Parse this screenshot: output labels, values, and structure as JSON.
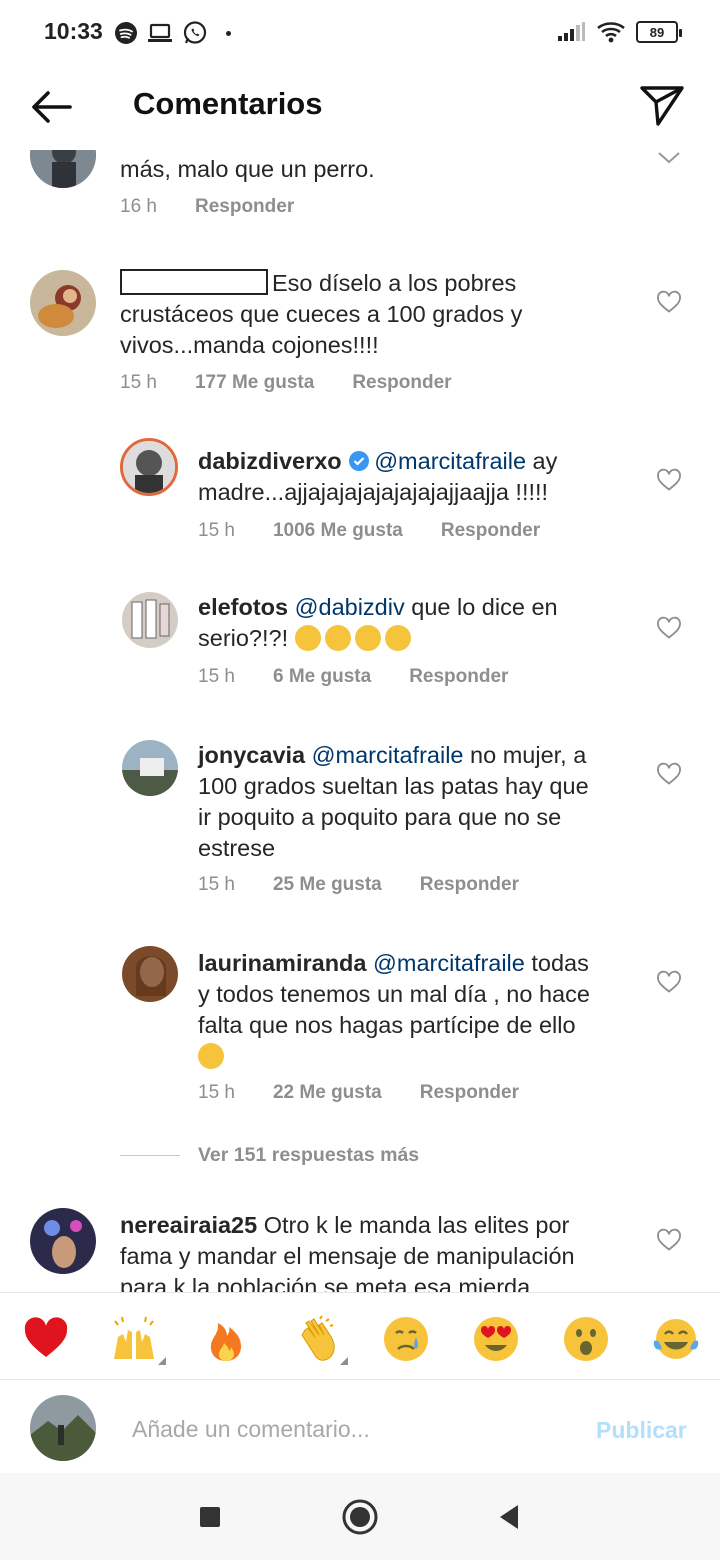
{
  "status_bar": {
    "time": "10:33",
    "icons": [
      "spotify-icon",
      "laptop-icon",
      "whatsapp-icon",
      "notification-dot"
    ],
    "battery": "89"
  },
  "header": {
    "title": "Comentarios"
  },
  "comments": [
    {
      "text": "más, malo que un perro.",
      "time": "16 h",
      "reply": "Responder"
    },
    {
      "text": "Eso díselo a los pobres crustáceos que cueces a 100 grados y vivos...manda cojones!!!!",
      "time": "15 h",
      "likes": "177 Me gusta",
      "reply": "Responder"
    },
    {
      "username": "dabizdiverxo",
      "mention": "@marcitafraile",
      "text_a": " ay",
      "text_b": "madre...ajjajajajajajajajajjaajja !!!!!",
      "time": "15 h",
      "likes": "1006 Me gusta",
      "reply": "Responder"
    },
    {
      "username": "elefotos",
      "mention": "@dabizdiv",
      "text_a": " que lo dice en",
      "text_b": "serio?!?!",
      "time": "15 h",
      "likes": "6 Me gusta",
      "reply": "Responder"
    },
    {
      "username": "jonycavia",
      "mention": "@marcitafraile",
      "text_a": " no mujer, a",
      "text_b": "100 grados sueltan las patas hay que",
      "text_c": "ir poquito a poquito para que no se",
      "text_d": "estrese",
      "time": "15 h",
      "likes": "25 Me gusta",
      "reply": "Responder"
    },
    {
      "username": "laurinamiranda",
      "mention": "@marcitafraile",
      "text_a": " todas",
      "text_b": "y todos tenemos un mal día , no hace",
      "text_c": "falta que nos hagas partícipe de ello",
      "time": "15 h",
      "likes": "22 Me gusta",
      "reply": "Responder"
    },
    {
      "username": "nereairaia25",
      "text_a": " Otro k le manda las elites por",
      "text_b": "fama y mandar el mensaje de manipulación",
      "text_c": "para k la población se meta esa mierda"
    }
  ],
  "view_more": "Ver 151 respuestas más",
  "reactions": [
    "red-heart",
    "raising-hands",
    "fire",
    "clapping-hands",
    "crying-face",
    "heart-eyes",
    "surprised-face",
    "tears-of-joy"
  ],
  "compose": {
    "placeholder": "Añade un comentario...",
    "publish": "Publicar"
  },
  "colors": {
    "mention": "#00376b",
    "meta": "#8e8e8e",
    "publish_disabled": "#b2dffc",
    "verified": "#3897f0"
  }
}
